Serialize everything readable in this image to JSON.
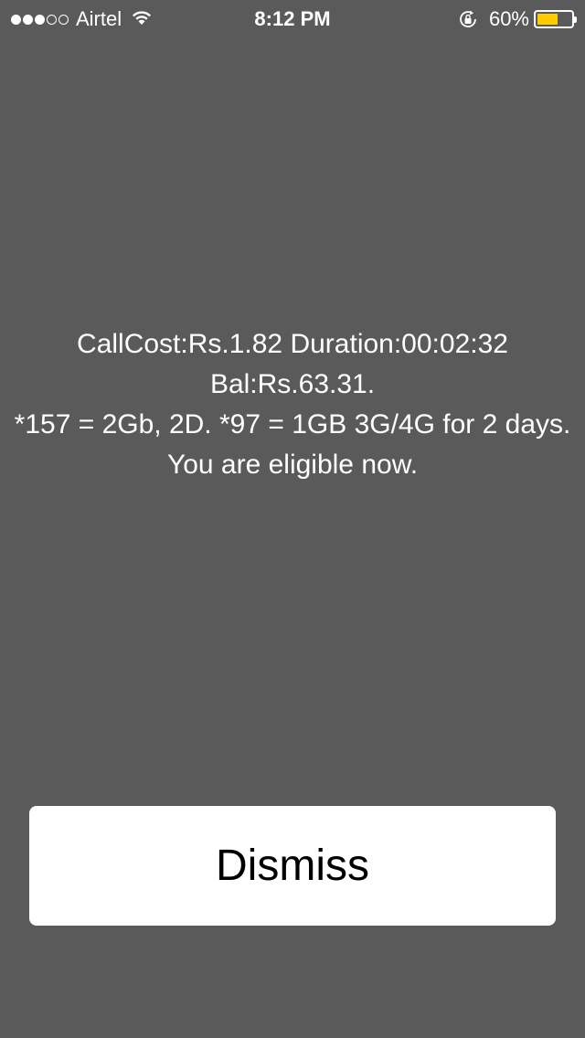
{
  "status_bar": {
    "signal_bars_filled": 3,
    "signal_bars_total": 5,
    "carrier": "Airtel",
    "time": "8:12 PM",
    "battery_percent_text": "60%",
    "battery_level": 0.6,
    "battery_color": "#ffcc00"
  },
  "message": {
    "line1": "CallCost:Rs.1.82 Duration:00:02:32",
    "line2": "Bal:Rs.63.31.",
    "line3": "*157 = 2Gb, 2D. *97 = 1GB 3G/4G for 2 days. You are eligible now."
  },
  "dismiss_button": {
    "label": "Dismiss"
  },
  "colors": {
    "background": "#5a5a5a",
    "text": "#ffffff",
    "button_bg": "#ffffff",
    "button_text": "#000000"
  }
}
